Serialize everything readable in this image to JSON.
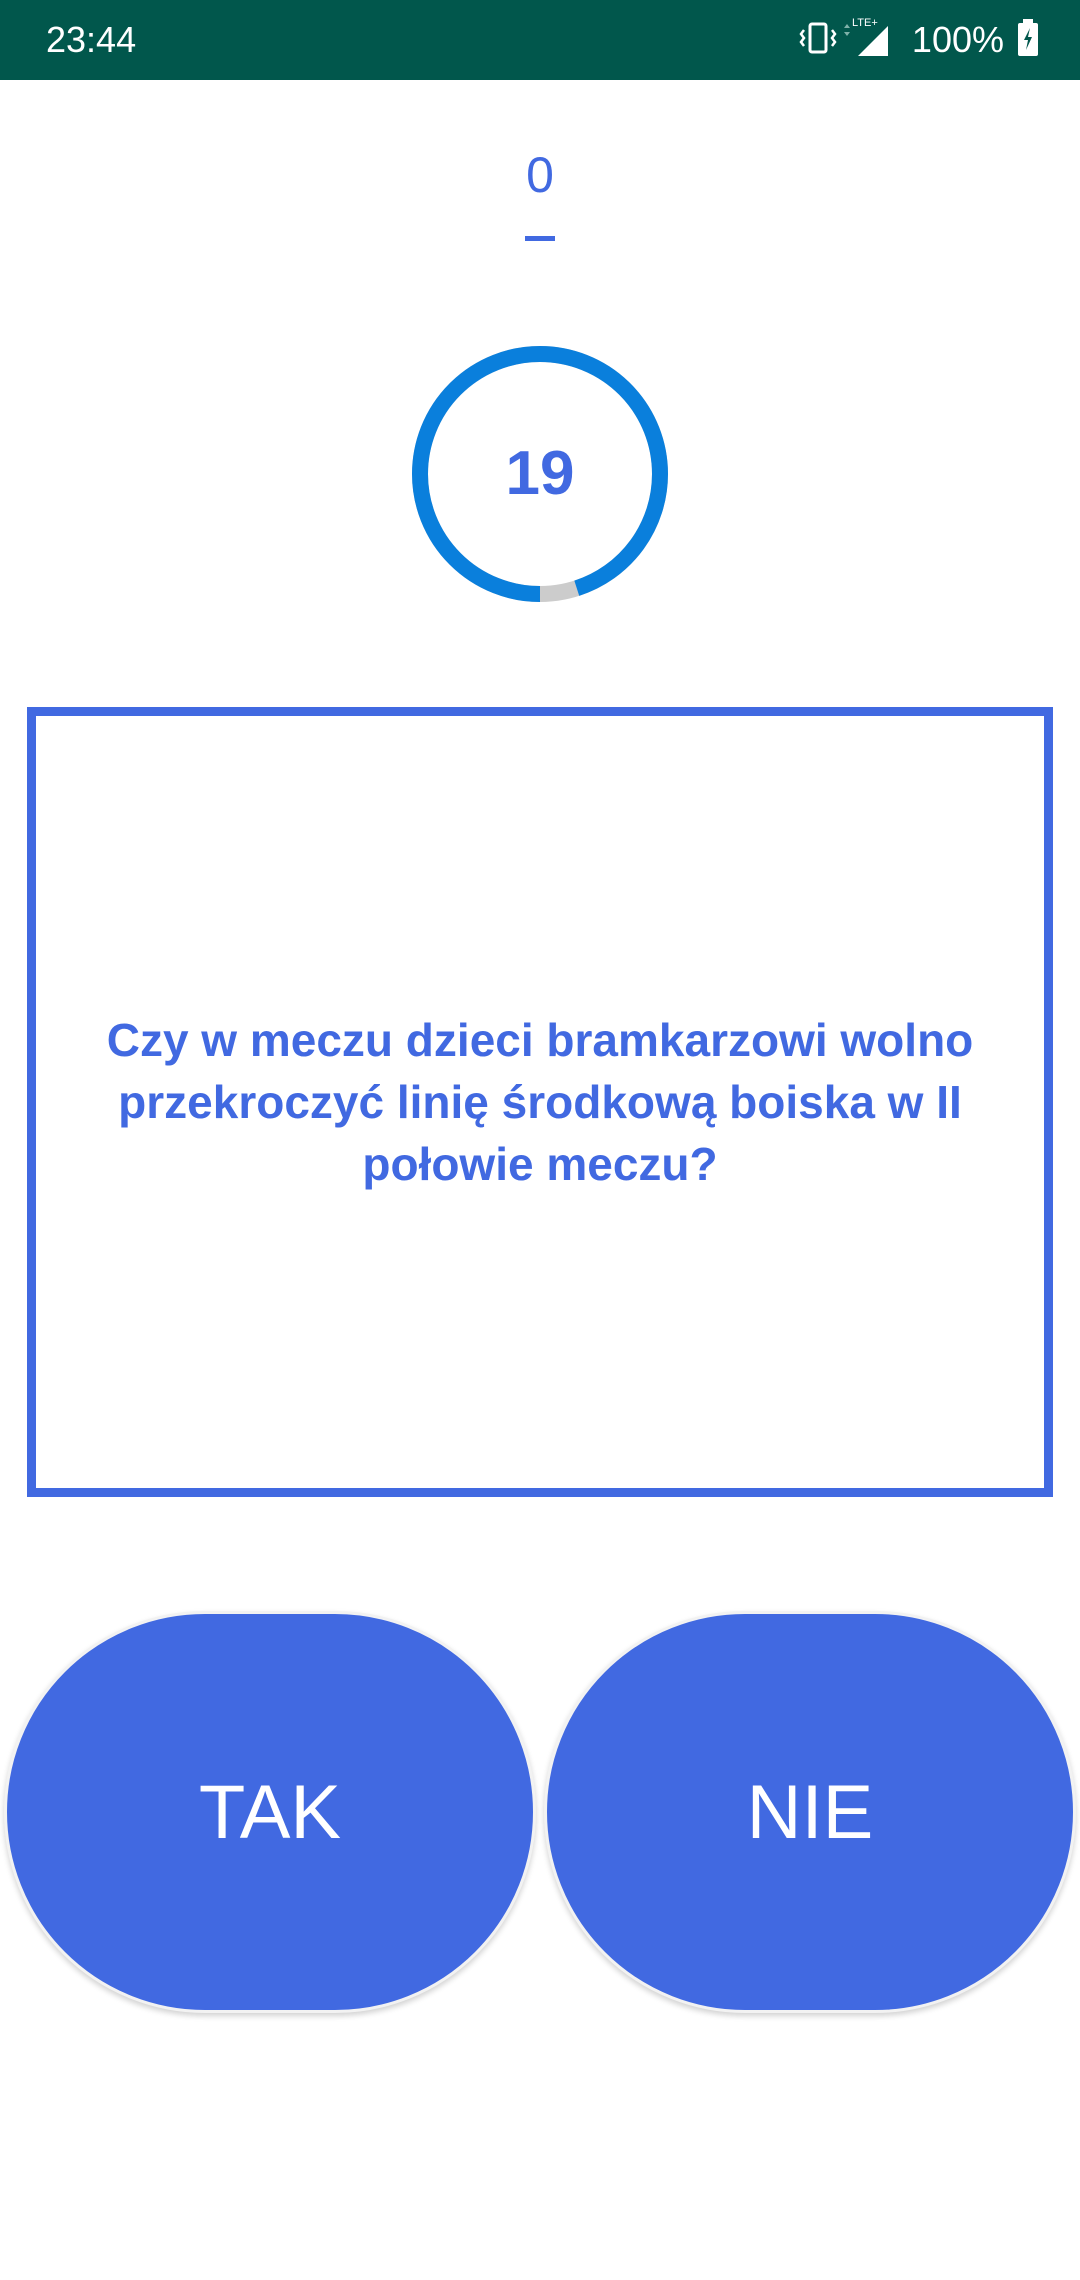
{
  "status_bar": {
    "time": "23:44",
    "battery": "100%",
    "icons": [
      "vibrate-icon",
      "network-lte-icon",
      "signal-icon",
      "battery-charging-icon"
    ],
    "network_label": "LTE+"
  },
  "score": {
    "value": "0"
  },
  "timer": {
    "seconds": "19",
    "remaining_fraction": 0.95,
    "colors": {
      "progress": "#0a7fdc",
      "track": "#cccccc"
    }
  },
  "question": {
    "text": "Czy w meczu dzieci bramkarzowi wolno przekroczyć linię środkową boiska w II połowie meczu?"
  },
  "answers": {
    "yes_label": "TAK",
    "no_label": "NIE"
  },
  "colors": {
    "accent": "#4169e1",
    "status_bar": "#01574c"
  }
}
